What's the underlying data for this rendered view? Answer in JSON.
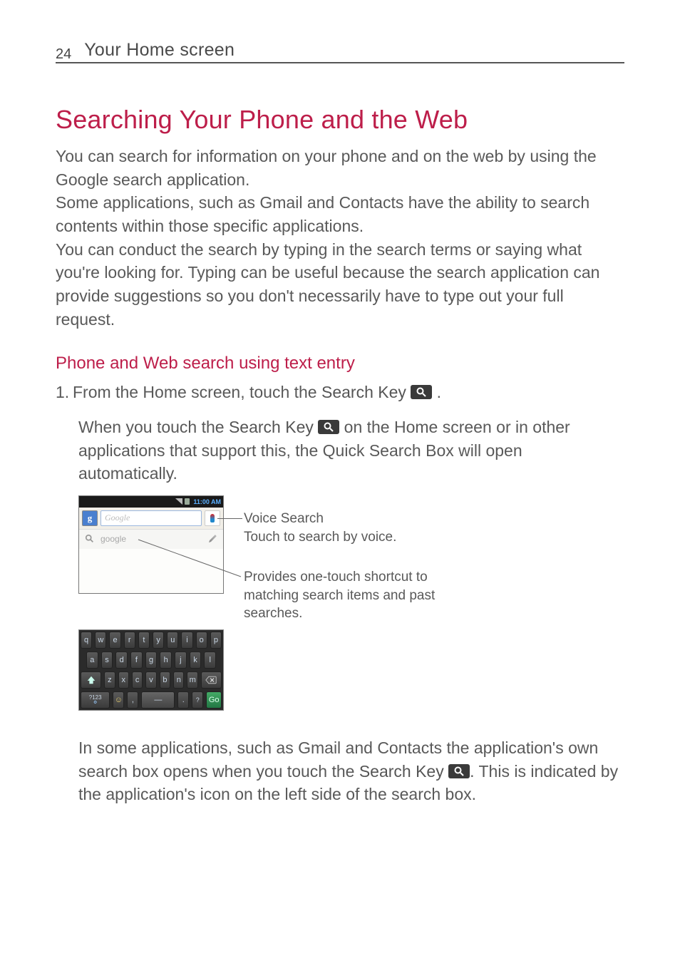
{
  "header": {
    "page_number": "24",
    "section": "Your Home screen"
  },
  "h1": "Searching Your Phone and the Web",
  "intro_p1": "You can search for information on your phone and on the web by using the Google search application.",
  "intro_p2": "Some applications, such as Gmail and Contacts have the ability to search contents within those specific applications.",
  "intro_p3": "You can conduct the search by typing in the search terms or saying what you're looking for. Typing can be useful because the search application can provide suggestions so you don't necessarily have to type out your full request.",
  "h2": "Phone and Web search using text entry",
  "step1_num": "1.",
  "step1_a": "From the Home screen, touch the ",
  "step1_b": "Search Key",
  "step1_c": " .",
  "step1_detail_a": "When you touch the ",
  "step1_detail_b": "Search Key",
  "step1_detail_c": " on the Home screen or in other applications that support this, the Quick Search Box will open automatically.",
  "phone": {
    "time": "11:00 AM",
    "g": "g",
    "search_placeholder": "Google",
    "suggest": "google"
  },
  "keyboard": {
    "row1": [
      "q",
      "w",
      "e",
      "r",
      "t",
      "y",
      "u",
      "i",
      "o",
      "p"
    ],
    "row2": [
      "a",
      "s",
      "d",
      "f",
      "g",
      "h",
      "j",
      "k",
      "l"
    ],
    "row3_mid": [
      "z",
      "x",
      "c",
      "v",
      "b",
      "n",
      "m"
    ],
    "sym": "?123",
    "go": "Go"
  },
  "callouts": {
    "voice_title": "Voice Search",
    "voice_sub": "Touch to search by voice.",
    "shortcut": "Provides one-touch shortcut to matching search items and past searches."
  },
  "after_a": "In some applications, such as Gmail and Contacts the application's own search box opens when you touch the ",
  "after_b": "Search Key",
  "after_c": ". This is indicated by the application's icon on the left side of the search box."
}
